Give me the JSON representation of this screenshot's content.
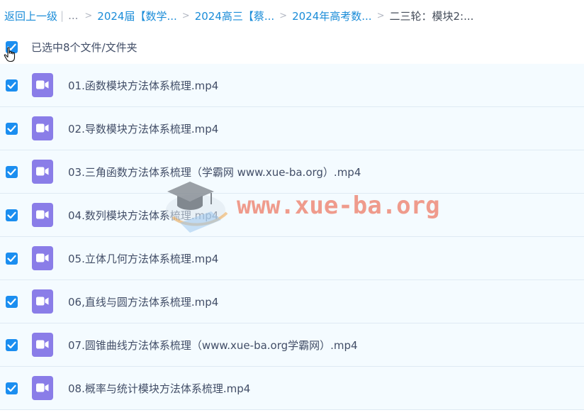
{
  "breadcrumb": {
    "back": "返回上一级",
    "separator": "|",
    "ellipsis": "...",
    "arrow": ">",
    "items": [
      "2024届【数学...",
      "2024高三【蔡...",
      "2024年高考数..."
    ],
    "current": "二三轮：模块2:..."
  },
  "selection": {
    "checked": true,
    "text": "已选中8个文件/文件夹"
  },
  "files": [
    {
      "name": "01.函数模块方法体系梳理.mp4",
      "checked": true,
      "icon": "video-file-icon"
    },
    {
      "name": "02.导数模块方法体系梳理.mp4",
      "checked": true,
      "icon": "video-file-icon"
    },
    {
      "name": "03.三角函数方法体系梳理（学霸网 www.xue-ba.org）.mp4",
      "checked": true,
      "icon": "video-file-icon"
    },
    {
      "name": "04.数列模块方法体系梳理.mp4",
      "checked": true,
      "icon": "video-file-icon"
    },
    {
      "name": "05.立体几何方法体系梳理.mp4",
      "checked": true,
      "icon": "video-file-icon"
    },
    {
      "name": "06,直线与圆方法体系梳理.mp4",
      "checked": true,
      "icon": "video-file-icon"
    },
    {
      "name": "07.圆锥曲线方法体系梳理（www.xue-ba.org学霸网）.mp4",
      "checked": true,
      "icon": "video-file-icon"
    },
    {
      "name": "08.概率与统计模块方法体系梳理.mp4",
      "checked": true,
      "icon": "video-file-icon"
    }
  ],
  "watermark": {
    "text": "www.xue-ba.org",
    "icon": "graduation-cap-icon"
  },
  "colors": {
    "accent": "#1b8ef0",
    "link": "#1a8cd8",
    "video_icon": "#8a7de8",
    "row_bg": "#f4fbff",
    "watermark": "#ec5f46"
  }
}
